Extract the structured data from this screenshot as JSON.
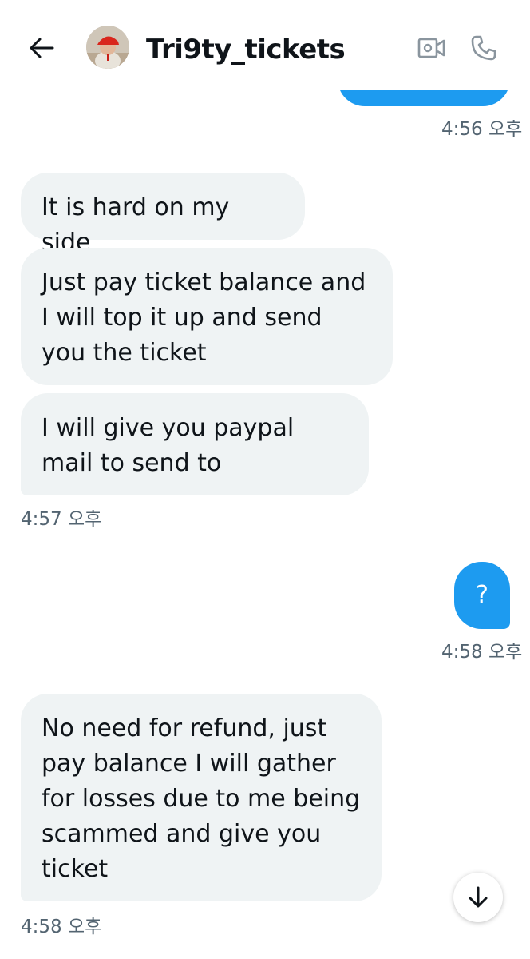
{
  "header": {
    "contact_name": "Tri9ty_tickets",
    "icons": {
      "back": "arrow-left-icon",
      "video": "video-camera-icon",
      "call": "phone-icon"
    }
  },
  "messages": [
    {
      "direction": "outgoing",
      "text": ""
    },
    {
      "direction": "incoming",
      "text": "It is hard on my side"
    },
    {
      "direction": "incoming",
      "text": "Just pay ticket balance and I will top it up and send you the ticket"
    },
    {
      "direction": "incoming",
      "text": "I will give you paypal mail to send to"
    },
    {
      "direction": "outgoing",
      "text": "?"
    },
    {
      "direction": "incoming",
      "text": "No need for refund, just pay balance I will gather for losses due to me being scammed and give you ticket"
    }
  ],
  "timestamps": [
    "4:56 오후",
    "4:57 오후",
    "4:58 오후",
    "4:58 오후"
  ],
  "scroll_button_icon": "arrow-down-icon",
  "colors": {
    "outgoing_bubble": "#1d9bf0",
    "incoming_bubble": "#eff3f4",
    "text": "#0f1419",
    "timestamp": "#536471"
  }
}
